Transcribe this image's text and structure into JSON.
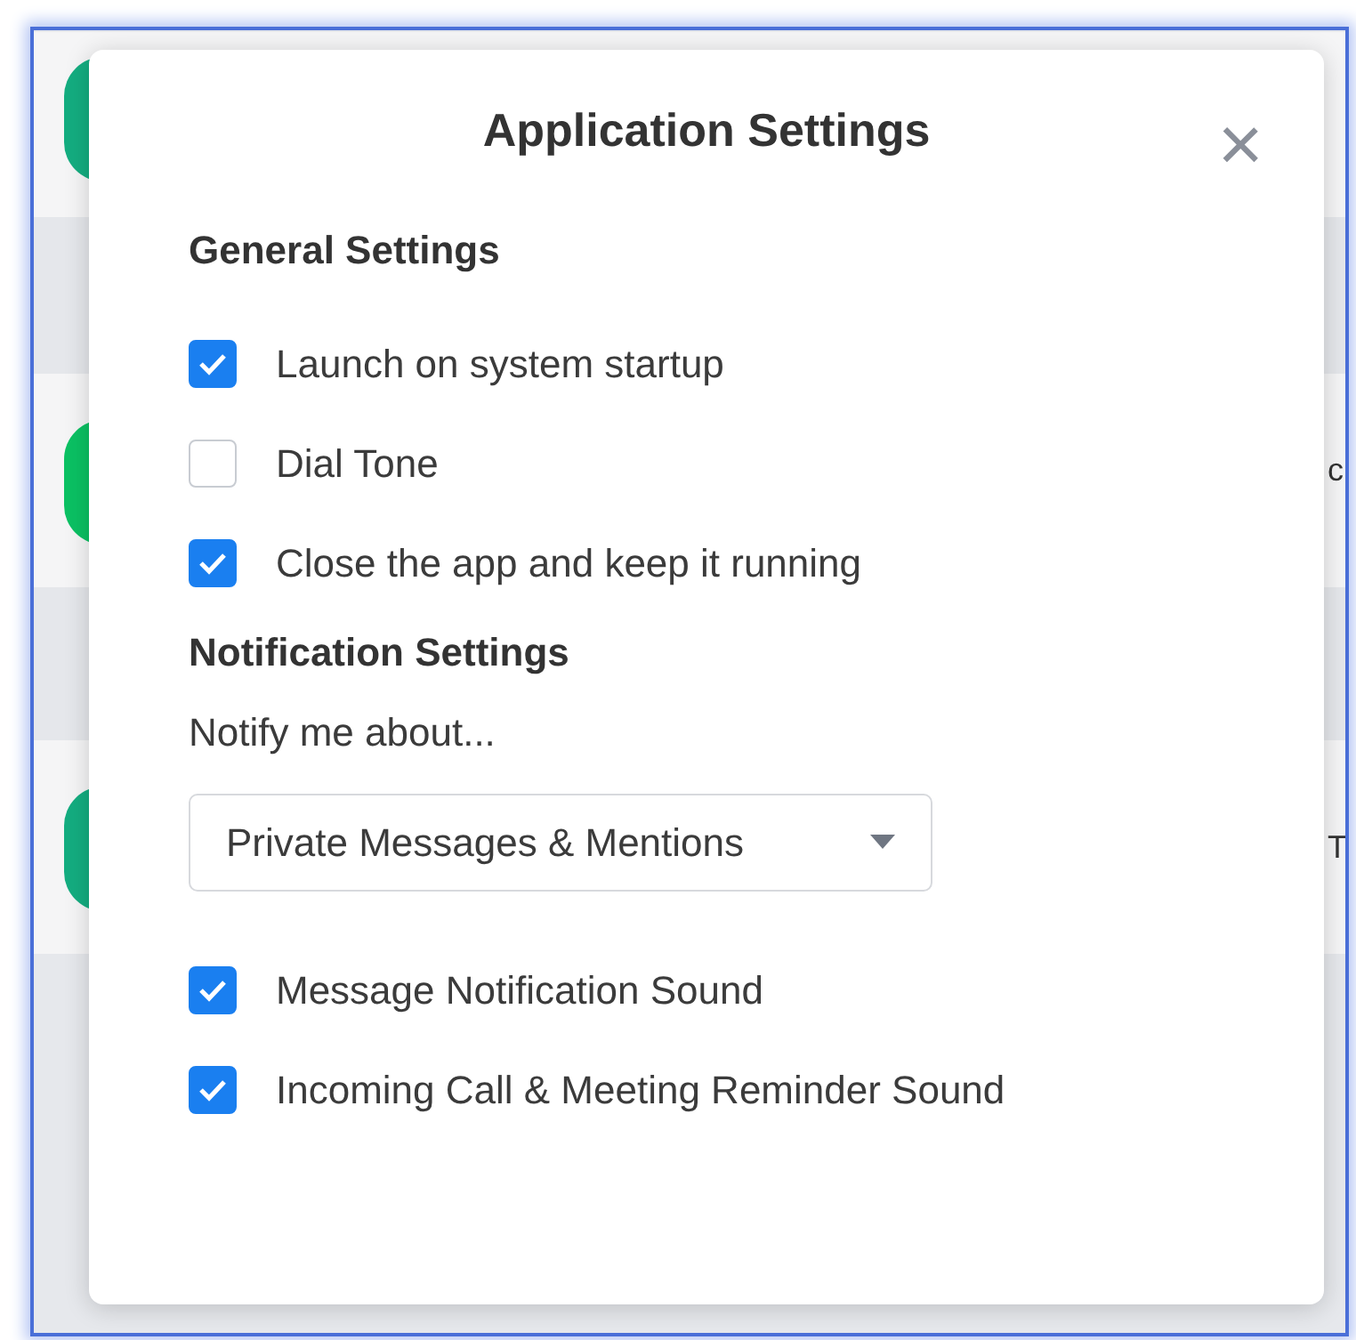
{
  "background_rows": [
    {
      "color": "#14ad80"
    },
    {
      "color": "#0bc163",
      "peek_text": "c"
    },
    {
      "color": "#14ad80",
      "peek_text": "T"
    }
  ],
  "dialog": {
    "title": "Application Settings",
    "close": "×",
    "sections": [
      {
        "heading": "General Settings",
        "items": [
          {
            "kind": "checkbox",
            "label": "Launch on system startup",
            "checked": true
          },
          {
            "kind": "checkbox",
            "label": "Dial Tone",
            "checked": false
          },
          {
            "kind": "checkbox",
            "label": "Close the app and keep it running",
            "checked": true
          }
        ]
      },
      {
        "heading": "Notification Settings",
        "items": [
          {
            "kind": "text",
            "label": "Notify me about..."
          },
          {
            "kind": "select",
            "value": "Private Messages & Mentions"
          },
          {
            "kind": "checkbox",
            "label": "Message Notification Sound",
            "checked": true
          },
          {
            "kind": "checkbox",
            "label": "Incoming Call & Meeting Reminder Sound",
            "checked": true
          }
        ]
      }
    ]
  }
}
